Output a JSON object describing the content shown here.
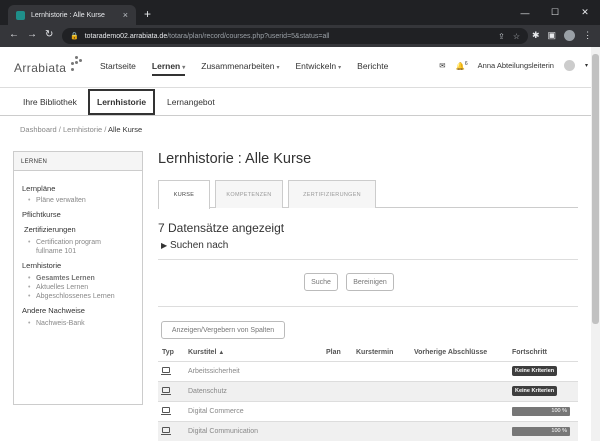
{
  "browser": {
    "tab_title": "Lernhistorie : Alle Kurse",
    "tab_close": "×",
    "new_tab": "+",
    "url_host": "totarademo02.arrabiata.de",
    "url_path": "/totara/plan/record/courses.php?userid=5&status=all",
    "window_controls": [
      "—",
      "☐",
      "✕"
    ]
  },
  "header": {
    "logo": "Arrabiata",
    "nav": [
      {
        "label": "Startseite",
        "active": false,
        "dropdown": false
      },
      {
        "label": "Lernen",
        "active": true,
        "dropdown": true
      },
      {
        "label": "Zusammenarbeiten",
        "active": false,
        "dropdown": true
      },
      {
        "label": "Entwickeln",
        "active": false,
        "dropdown": true
      },
      {
        "label": "Berichte",
        "active": false,
        "dropdown": false
      }
    ],
    "user_name": "Anna Abteilungsleiterin",
    "notification_count": "6"
  },
  "subnav": {
    "items": [
      "Ihre Bibliothek",
      "Lernhistorie",
      "Lernangebot"
    ]
  },
  "breadcrumb": {
    "items": [
      "Dashboard",
      "Lernhistorie"
    ],
    "separator": "/",
    "current": "Alle Kurse"
  },
  "sidebar": {
    "heading": "LERNEN",
    "plaene": "Lernpläne",
    "plaene_verwalten": "Pläne verwalten",
    "pflichtkurse": "Pflichtkurse",
    "zertifizierungen": "Zertifizierungen",
    "cert_program_1": "Certification program",
    "cert_program_2": "fullname 101",
    "lernhistorie": "Lernhistorie",
    "gesamtes": "Gesamtes Lernen",
    "aktuelles": "Aktuelles Lernen",
    "abgeschlossenes": "Abgeschlossenes Lernen",
    "andere": "Andere Nachweise",
    "nachweis_bank": "Nachweis-Bank"
  },
  "main": {
    "title": "Lernhistorie : Alle Kurse",
    "tabs": [
      "KURSE",
      "KOMPETENZEN",
      "ZERTIFIZIERUNGEN"
    ],
    "record_count": "7 Datensätze angezeigt",
    "search_toggle": "Suchen nach",
    "search_button": "Suche",
    "reset_button": "Bereinigen",
    "columns_button": "Anzeigen/Vergebern von Spalten",
    "table": {
      "headers": [
        "Typ",
        "Kurstitel",
        "Plan",
        "Kurstermin",
        "Vorherige Abschlüsse",
        "Fortschritt"
      ],
      "rows": [
        {
          "title": "Arbeitssicherheit",
          "progress_label": "Keine Kriterien",
          "progress_type": "badge"
        },
        {
          "title": "Datenschutz",
          "progress_label": "Keine Kriterien",
          "progress_type": "badge"
        },
        {
          "title": "Digital Commerce",
          "progress_label": "100 %",
          "progress_type": "bar",
          "progress_value": 100
        },
        {
          "title": "Digital Communication",
          "progress_label": "100 %",
          "progress_type": "bar",
          "progress_value": 100
        }
      ]
    }
  }
}
